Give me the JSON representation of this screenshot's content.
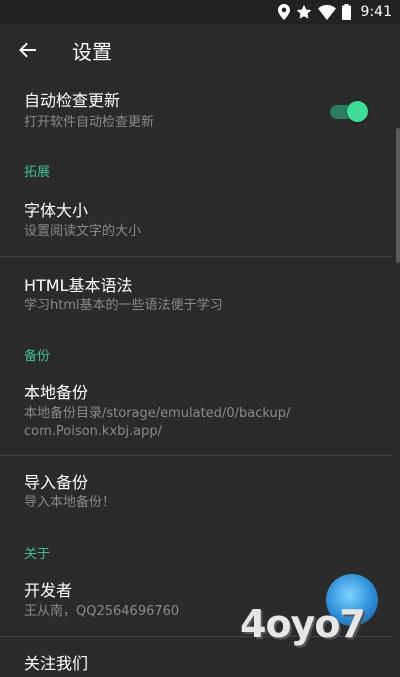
{
  "status_bar": {
    "time": "9:41",
    "icons": [
      "location-pin-icon",
      "star-icon",
      "wifi-icon",
      "battery-icon"
    ]
  },
  "app_bar": {
    "title": "设置",
    "back_icon": "arrow-back-icon"
  },
  "preferences": {
    "auto_update": {
      "title": "自动检查更新",
      "summary": "打开软件自动检查更新",
      "enabled": true
    },
    "extension_category": "拓展",
    "font_size": {
      "title": "字体大小",
      "summary": "设置阅读文字的大小"
    },
    "html_syntax": {
      "title": "HTML基本语法",
      "summary": "学习html基本的一些语法便于学习"
    },
    "backup_category": "备份",
    "local_backup": {
      "title": "本地备份",
      "summary_line1": "本地备份目录/storage/emulated/0/backup/",
      "summary_line2": "com.Poison.kxbj.app/"
    },
    "import_backup": {
      "title": "导入备份",
      "summary": "导入本地备份！"
    },
    "about_category": "关于",
    "developer": {
      "title": "开发者",
      "summary": "王从南，QQ2564696760"
    },
    "about_us": {
      "title": "关注我们"
    }
  },
  "watermark": {
    "text": "4oyo7"
  },
  "colors": {
    "background": "#2b2b2b",
    "accent": "#3fbf8f",
    "switch_thumb": "#3ddc97",
    "summary_text": "#8a8a8a"
  }
}
